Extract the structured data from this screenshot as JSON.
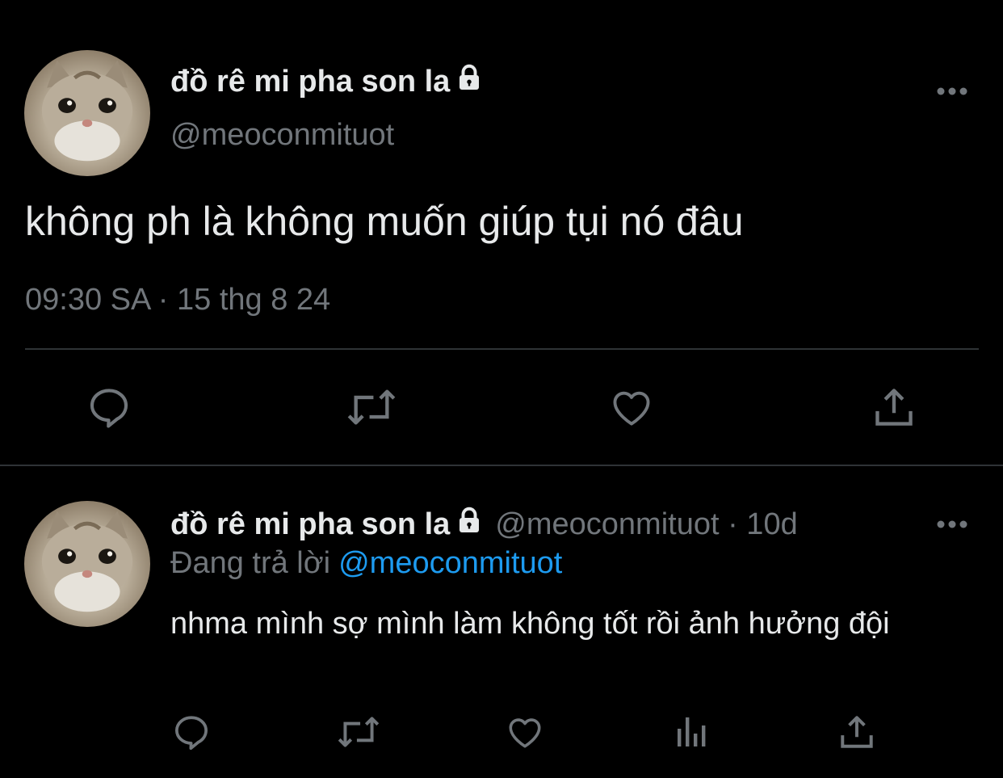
{
  "main_tweet": {
    "display_name": "đồ rê mi pha son la",
    "handle": "@meoconmituot",
    "text": "không ph là không muốn giúp tụi nó đâu",
    "timestamp": "09:30 SA · 15 thg 8 24",
    "icons": {
      "lock": "lock-icon",
      "more": "more-horizontal-icon",
      "reply": "reply-icon",
      "retweet": "retweet-icon",
      "like": "heart-icon",
      "share": "share-icon"
    }
  },
  "reply_tweet": {
    "display_name": "đồ rê mi pha son la",
    "handle_time": "@meoconmituot · 10d",
    "replying_to_label": "Đang trả lời",
    "replying_to_handle": "@meoconmituot",
    "text": "nhma mình sợ mình làm không tốt rồi ảnh hưởng đội",
    "icons": {
      "reply": "reply-icon",
      "retweet": "retweet-icon",
      "like": "heart-icon",
      "analytics": "analytics-icon",
      "share": "share-icon"
    }
  },
  "colors": {
    "background": "#000000",
    "text_primary": "#e7e9ea",
    "text_secondary": "#71767b",
    "accent": "#1d9bf0",
    "divider": "#2f3336"
  }
}
